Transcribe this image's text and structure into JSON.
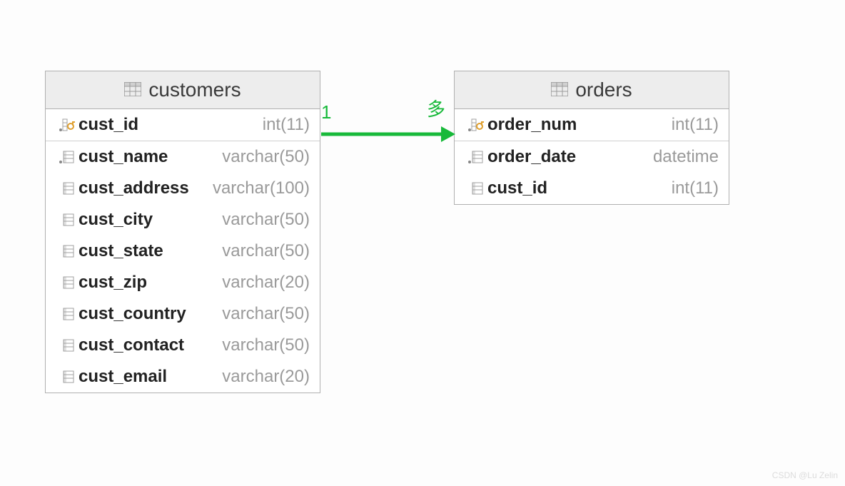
{
  "relation": {
    "from_label": "1",
    "to_label": "多"
  },
  "tables": {
    "customers": {
      "title": "customers",
      "columns": [
        {
          "name": "cust_id",
          "type": "int(11)",
          "pk": true
        },
        {
          "name": "cust_name",
          "type": "varchar(50)",
          "pk": false
        },
        {
          "name": "cust_address",
          "type": "varchar(100)",
          "pk": false
        },
        {
          "name": "cust_city",
          "type": "varchar(50)",
          "pk": false
        },
        {
          "name": "cust_state",
          "type": "varchar(50)",
          "pk": false
        },
        {
          "name": "cust_zip",
          "type": "varchar(20)",
          "pk": false
        },
        {
          "name": "cust_country",
          "type": "varchar(50)",
          "pk": false
        },
        {
          "name": "cust_contact",
          "type": "varchar(50)",
          "pk": false
        },
        {
          "name": "cust_email",
          "type": "varchar(20)",
          "pk": false
        }
      ]
    },
    "orders": {
      "title": "orders",
      "columns": [
        {
          "name": "order_num",
          "type": "int(11)",
          "pk": true
        },
        {
          "name": "order_date",
          "type": "datetime",
          "pk": false
        },
        {
          "name": "cust_id",
          "type": "int(11)",
          "pk": false
        }
      ]
    }
  },
  "watermark": "CSDN @Lu Zelin"
}
